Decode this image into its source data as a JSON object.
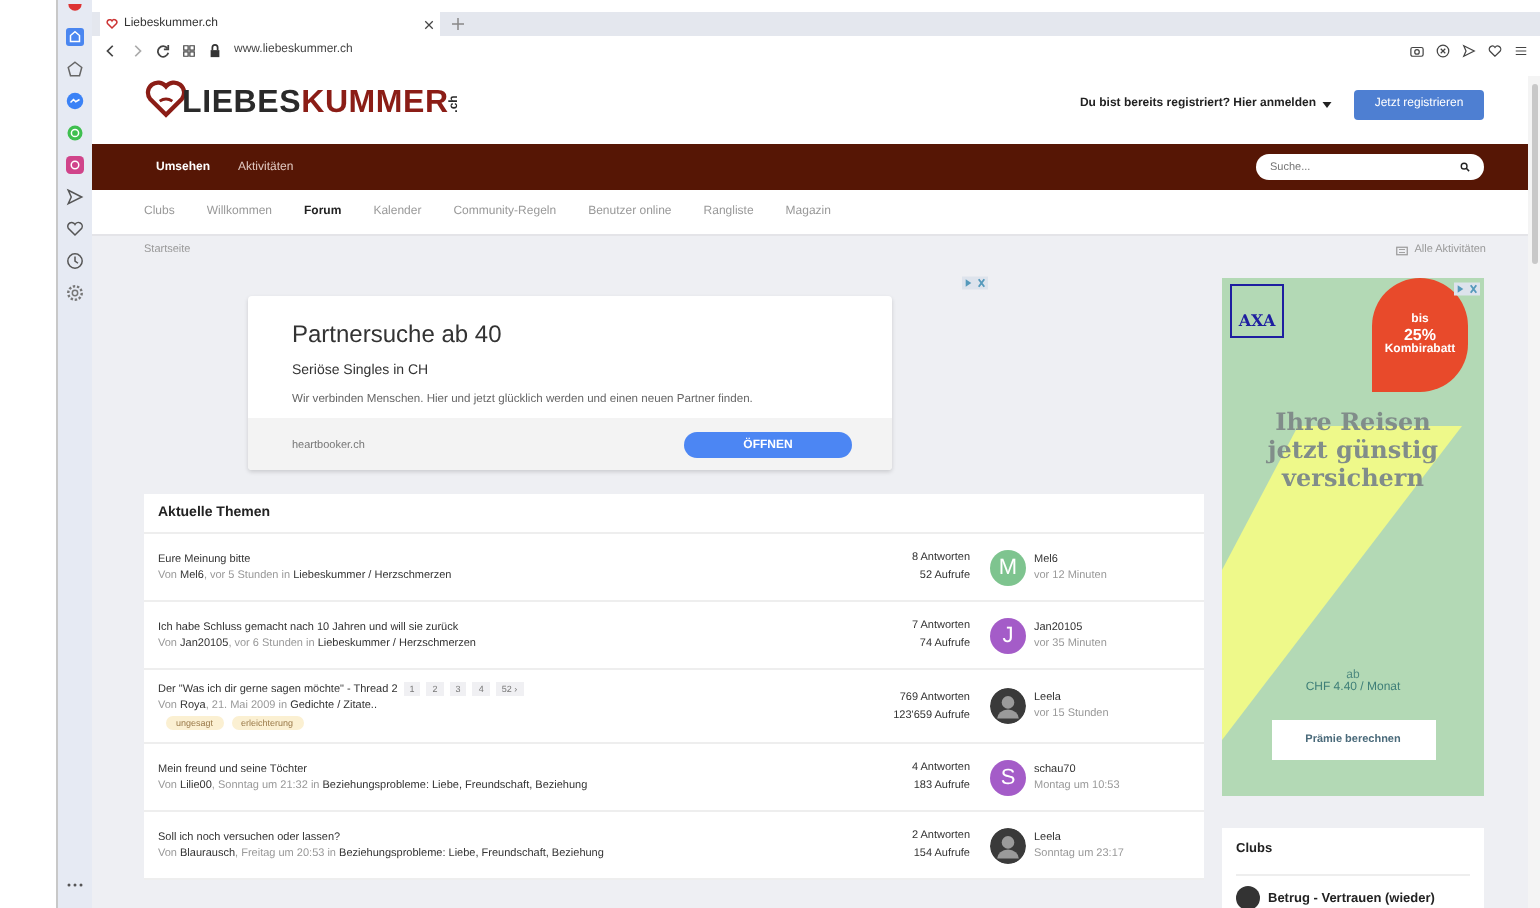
{
  "browser": {
    "tab_title": "Liebeskummer.ch",
    "url": "www.liebeskummer.ch"
  },
  "header": {
    "logo": {
      "text_dark": "LIEBES",
      "text_accent": "KUMMER",
      "suffix": ".ch"
    },
    "login_text": "Du bist bereits registriert? Hier anmelden",
    "register_button": "Jetzt registrieren"
  },
  "main_nav": [
    {
      "label": "Umsehen",
      "selected": true
    },
    {
      "label": "Aktivitäten",
      "selected": false
    }
  ],
  "search": {
    "placeholder": "Suche..."
  },
  "sub_nav": [
    {
      "label": "Clubs",
      "selected": false
    },
    {
      "label": "Willkommen",
      "selected": false
    },
    {
      "label": "Forum",
      "selected": true
    },
    {
      "label": "Kalender",
      "selected": false
    },
    {
      "label": "Community-Regeln",
      "selected": false
    },
    {
      "label": "Benutzer online",
      "selected": false
    },
    {
      "label": "Rangliste",
      "selected": false
    },
    {
      "label": "Magazin",
      "selected": false
    }
  ],
  "breadcrumb": "Startseite",
  "all_activities": "Alle Aktivitäten",
  "ad": {
    "title": "Partnersuche ab 40",
    "subtitle": "Seriöse Singles in CH",
    "text": "Wir verbinden Menschen. Hier und jetzt glücklich werden und einen neuen Partner finden.",
    "domain": "heartbooker.ch",
    "button": "ÖFFNEN"
  },
  "topics_title": "Aktuelle Themen",
  "topics": [
    {
      "title": "Eure Meinung bitte",
      "meta": "Von **Mel6**, vor 5 Stunden in **Liebeskummer / Herzschmerzen**",
      "replies": "8 Antworten",
      "views": "52 Aufrufe",
      "avatar": {
        "kind": "letter",
        "letter": "M",
        "color": "#7ec48f"
      },
      "last_user": "Mel6",
      "last_time": "vor 12 Minuten"
    },
    {
      "title": "Ich habe Schluss gemacht nach 10 Jahren und will sie zurück",
      "meta": "Von **Jan20105**, vor 6 Stunden in **Liebeskummer / Herzschmerzen**",
      "replies": "7 Antworten",
      "views": "74 Aufrufe",
      "avatar": {
        "kind": "letter",
        "letter": "J",
        "color": "#a45cc8"
      },
      "last_user": "Jan20105",
      "last_time": "vor 35 Minuten"
    },
    {
      "title": "Der \"Was ich dir gerne sagen möchte\" - Thread 2",
      "meta": "Von **Roya**, 21. Mai 2009 in **Gedichte / Zitate..**",
      "pages": [
        "1",
        "2",
        "3",
        "4",
        "52 ›"
      ],
      "tags": [
        "ungesagt",
        "erleichterung"
      ],
      "replies": "769 Antworten",
      "views": "123'659 Aufrufe",
      "avatar": {
        "kind": "photo"
      },
      "last_user": "Leela",
      "last_time": "vor 15 Stunden"
    },
    {
      "title": "Mein freund und seine Töchter",
      "meta": "Von **Lilie00**, Sonntag um 21:32 in **Beziehungsprobleme: Liebe, Freundschaft, Beziehung**",
      "replies": "4 Antworten",
      "views": "183 Aufrufe",
      "avatar": {
        "kind": "letter",
        "letter": "S",
        "color": "#a45cc8"
      },
      "last_user": "schau70",
      "last_time": "Montag um 10:53"
    },
    {
      "title": "Soll ich noch versuchen oder lassen?",
      "meta": "Von **Blaurausch**, Freitag um 20:53 in **Beziehungsprobleme: Liebe, Freundschaft, Beziehung**",
      "replies": "2 Antworten",
      "views": "154 Aufrufe",
      "avatar": {
        "kind": "photo"
      },
      "last_user": "Leela",
      "last_time": "Sonntag um 23:17"
    }
  ],
  "side_ad": {
    "logo": "AXA",
    "badge": [
      "bis",
      "25%",
      "Kombirabatt"
    ],
    "headline": "Ihre Reisen jetzt günstig versichern",
    "price_prefix": "ab",
    "price": "CHF 4.40 / Monat",
    "button": "Prämie berechnen"
  },
  "clubs": {
    "title": "Clubs",
    "items": [
      {
        "name": "Betrug - Vertrauen (wieder)"
      }
    ]
  }
}
